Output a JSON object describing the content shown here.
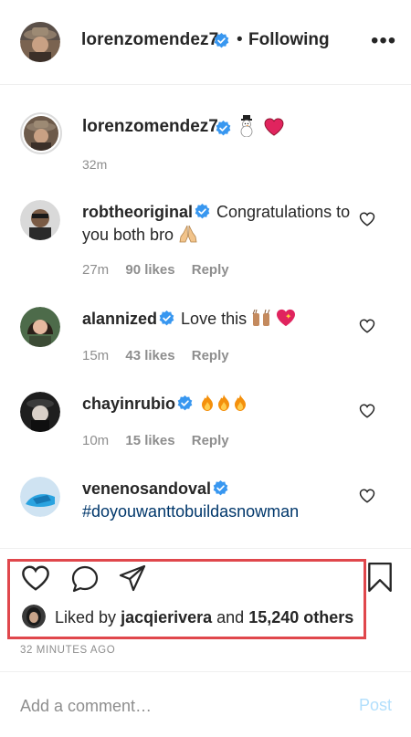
{
  "header": {
    "username": "lorenzomendez7",
    "dot": "•",
    "following": "Following",
    "more": "•••"
  },
  "caption": {
    "username": "lorenzomendez7",
    "time": "32m",
    "icons": [
      "verified-badge-icon",
      "snowman-icon",
      "red-heart-icon"
    ]
  },
  "comments": [
    {
      "username": "robtheoriginal",
      "text": "Congratulations to you both bro",
      "emoji": "folded-hands-icon",
      "time": "27m",
      "likes": "90 likes",
      "reply": "Reply"
    },
    {
      "username": "alannized",
      "text": "Love this",
      "emoji": "raised-hands-and-sparkling-heart-icons",
      "time": "15m",
      "likes": "43 likes",
      "reply": "Reply"
    },
    {
      "username": "chayinrubio",
      "text": "",
      "emoji": "fire-icons",
      "time": "10m",
      "likes": "15 likes",
      "reply": "Reply"
    },
    {
      "username": "venenosandoval",
      "text": "#doyouwanttobuildasnowman",
      "emoji": ""
    }
  ],
  "likes": {
    "prefix": "Liked by",
    "user": "jacqierivera",
    "and": "and",
    "others": "15,240 others"
  },
  "time_ago": "32 MINUTES AGO",
  "comment_box": {
    "placeholder": "Add a comment…",
    "post_label": "Post"
  },
  "colors": {
    "verified": "#3897f0",
    "highlight": "#e0474c",
    "post_disabled": "#b2dffc",
    "hashtag": "#00376b",
    "muted": "#8e8e8e"
  }
}
